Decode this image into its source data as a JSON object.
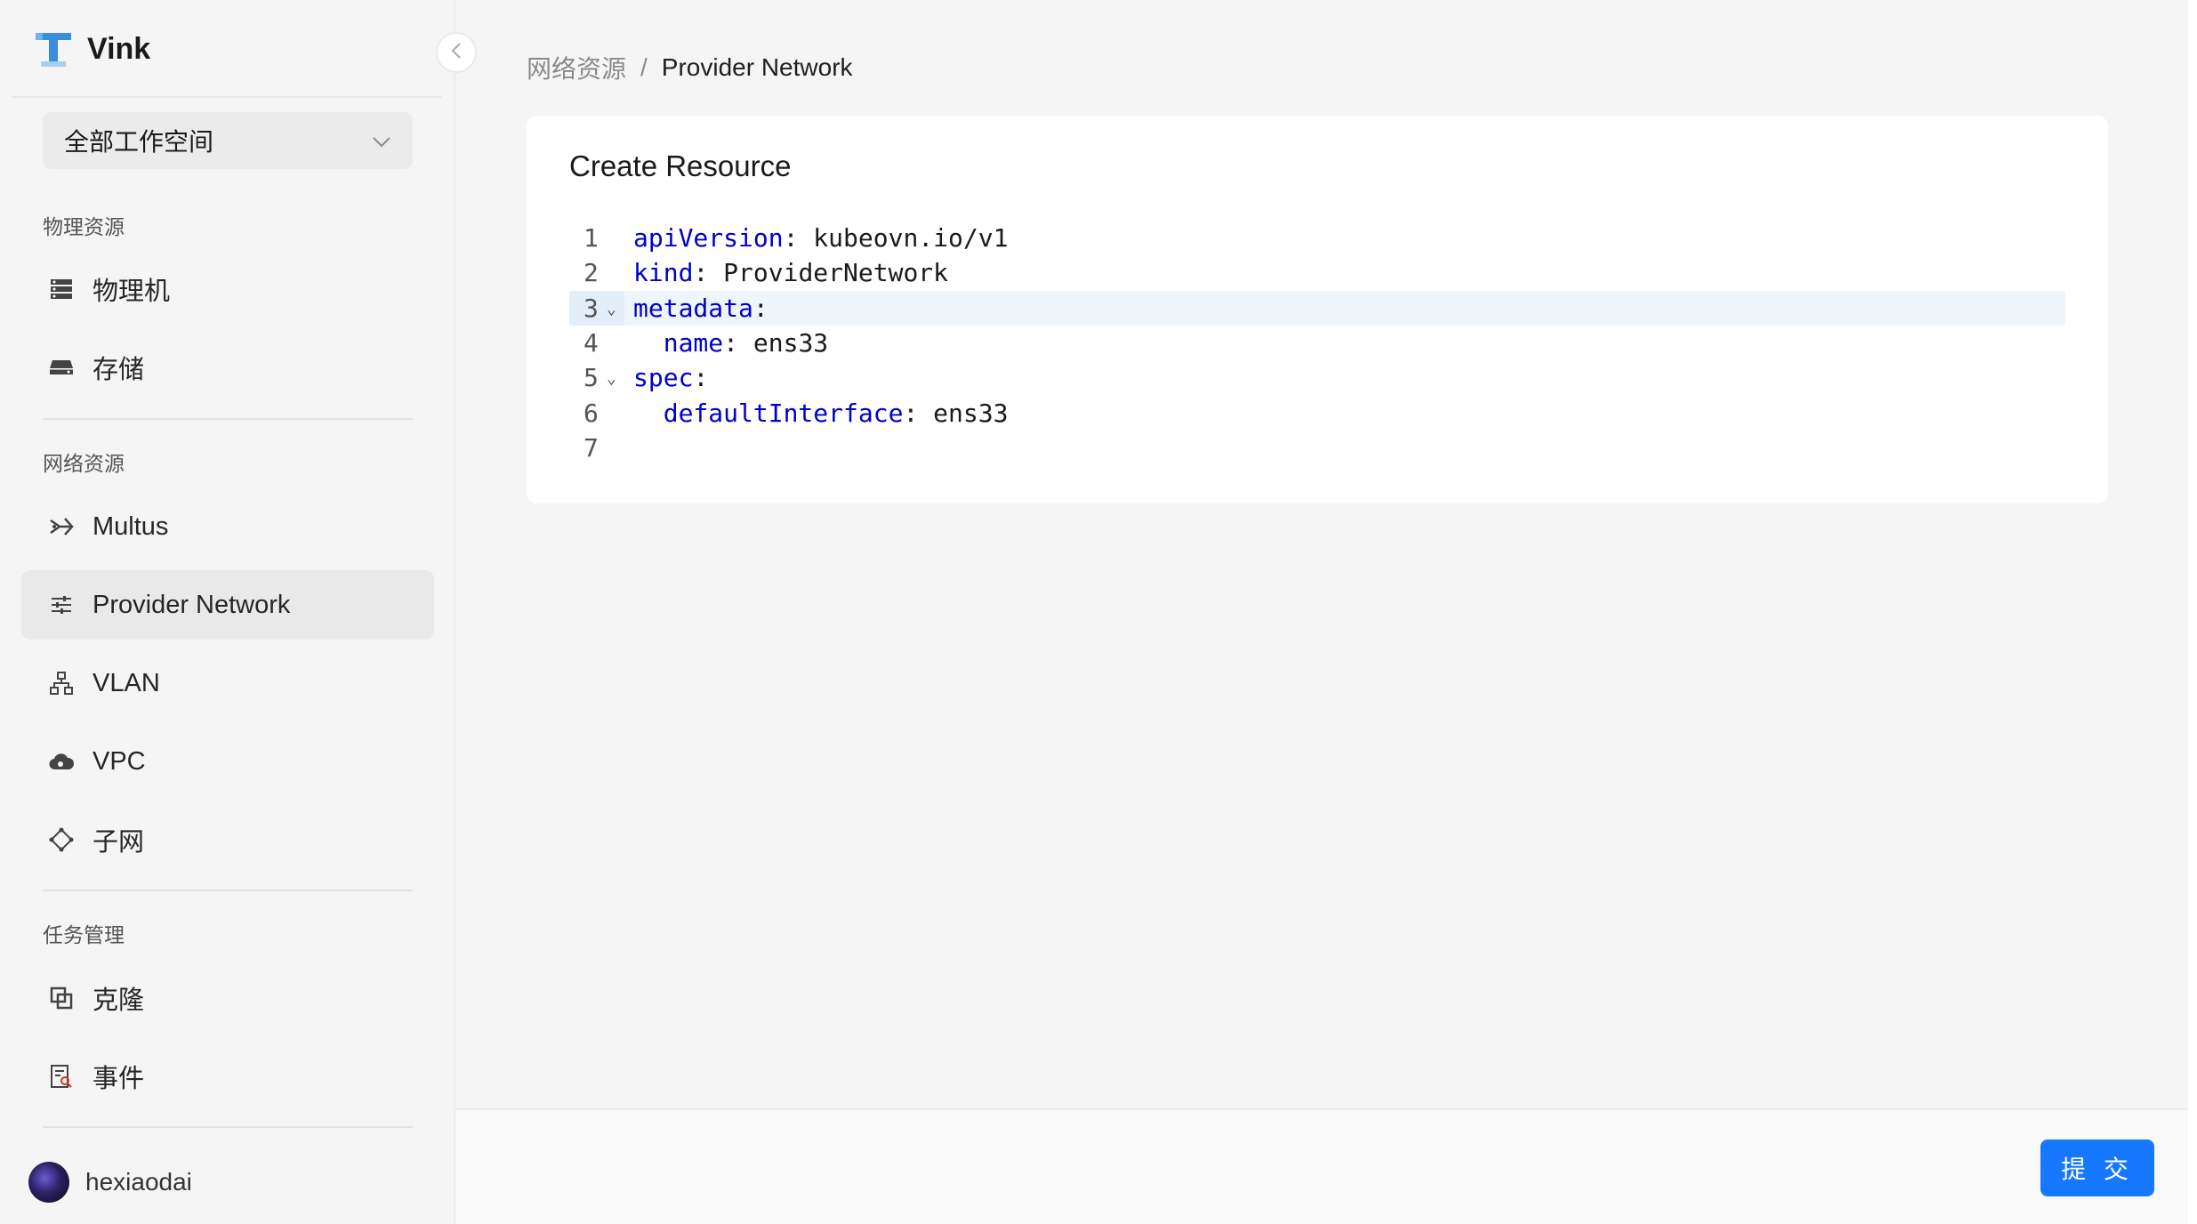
{
  "app": {
    "title": "Vink"
  },
  "workspace": {
    "selected": "全部工作空间"
  },
  "sidebar": {
    "groups": [
      {
        "label": "物理资源"
      },
      {
        "label": "网络资源"
      },
      {
        "label": "任务管理"
      }
    ],
    "items": [
      {
        "label": "物理机",
        "icon": "server-icon"
      },
      {
        "label": "存储",
        "icon": "storage-icon"
      },
      {
        "label": "Multus",
        "icon": "multus-icon"
      },
      {
        "label": "Provider Network",
        "icon": "sliders-icon",
        "active": true
      },
      {
        "label": "VLAN",
        "icon": "vlan-icon"
      },
      {
        "label": "VPC",
        "icon": "cloud-icon"
      },
      {
        "label": "子网",
        "icon": "subnet-icon"
      },
      {
        "label": "克隆",
        "icon": "clone-icon"
      },
      {
        "label": "事件",
        "icon": "event-icon"
      }
    ]
  },
  "user": {
    "name": "hexiaodai"
  },
  "breadcrumb": {
    "parent": "网络资源",
    "separator": "/",
    "current": "Provider Network"
  },
  "card": {
    "title": "Create Resource"
  },
  "editor": {
    "lines": [
      {
        "num": "1",
        "indent": "",
        "key": "apiVersion",
        "rest": ": kubeovn.io/v1"
      },
      {
        "num": "2",
        "indent": "",
        "key": "kind",
        "rest": ": ProviderNetwork"
      },
      {
        "num": "3",
        "indent": "",
        "key": "metadata",
        "rest": ":"
      },
      {
        "num": "4",
        "indent": "  ",
        "key": "name",
        "rest": ": ens33"
      },
      {
        "num": "5",
        "indent": "",
        "key": "spec",
        "rest": ":"
      },
      {
        "num": "6",
        "indent": "  ",
        "key": "defaultInterface",
        "rest": ": ens33"
      },
      {
        "num": "7",
        "indent": "",
        "key": "",
        "rest": ""
      }
    ]
  },
  "footer": {
    "submit_label": "提 交"
  },
  "colors": {
    "accent": "#1677ff",
    "yaml_key": "#0000c8",
    "active_line": "#eef6fc"
  }
}
